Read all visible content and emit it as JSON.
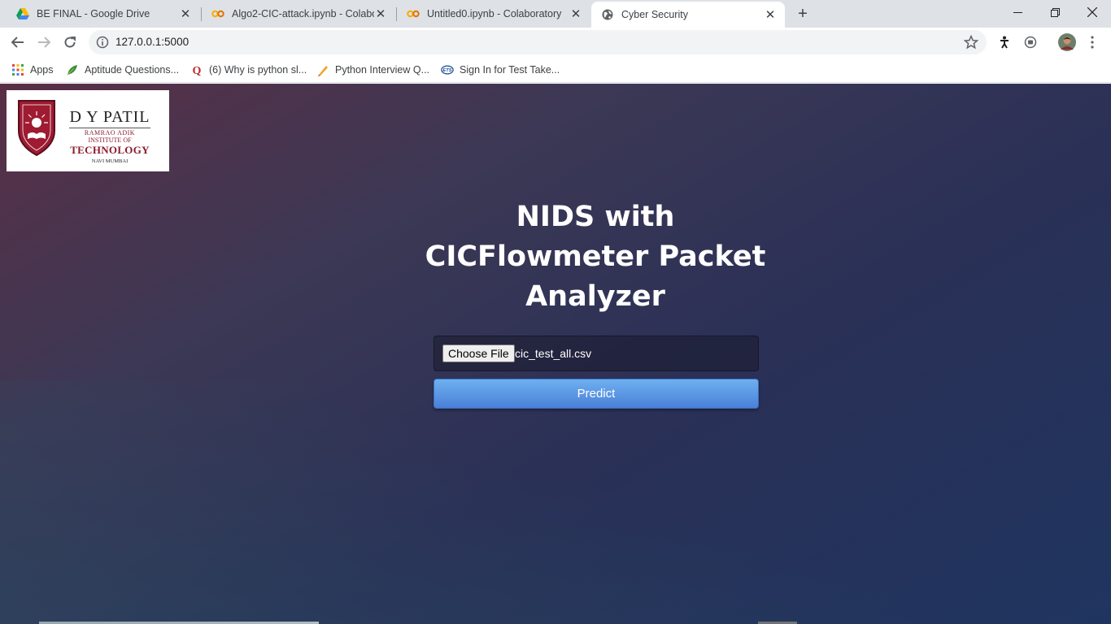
{
  "browser": {
    "tabs": [
      {
        "title": "BE FINAL - Google Drive",
        "icon": "google-drive-icon"
      },
      {
        "title": "Algo2-CIC-attack.ipynb - Colabor",
        "icon": "colab-icon"
      },
      {
        "title": "Untitled0.ipynb - Colaboratory",
        "icon": "colab-icon"
      },
      {
        "title": "Cyber Security",
        "icon": "globe-icon",
        "active": true
      }
    ],
    "address": "127.0.0.1:5000",
    "bookmarks": [
      {
        "label": "Apps",
        "icon": "apps-grid-icon"
      },
      {
        "label": "Aptitude Questions...",
        "icon": "bookmark-leaf-icon"
      },
      {
        "label": "(6) Why is python sl...",
        "icon": "quora-icon"
      },
      {
        "label": "Python Interview Q...",
        "icon": "bookmark-pen-icon"
      },
      {
        "label": "Sign In for Test Take...",
        "icon": "ets-icon"
      }
    ]
  },
  "page": {
    "logo": {
      "name": "D Y PATIL",
      "line2": "RAMRAO ADIK",
      "line3": "INSTITUTE OF",
      "line4": "TECHNOLOGY",
      "line5": "NAVI MUMBAI"
    },
    "heading": {
      "line1": "NIDS with",
      "line2": "CICFlowmeter Packet",
      "line3": "Analyzer"
    },
    "file_input": {
      "button_label": "Choose File",
      "filename": "cic_test_all.csv"
    },
    "predict_label": "Predict"
  }
}
